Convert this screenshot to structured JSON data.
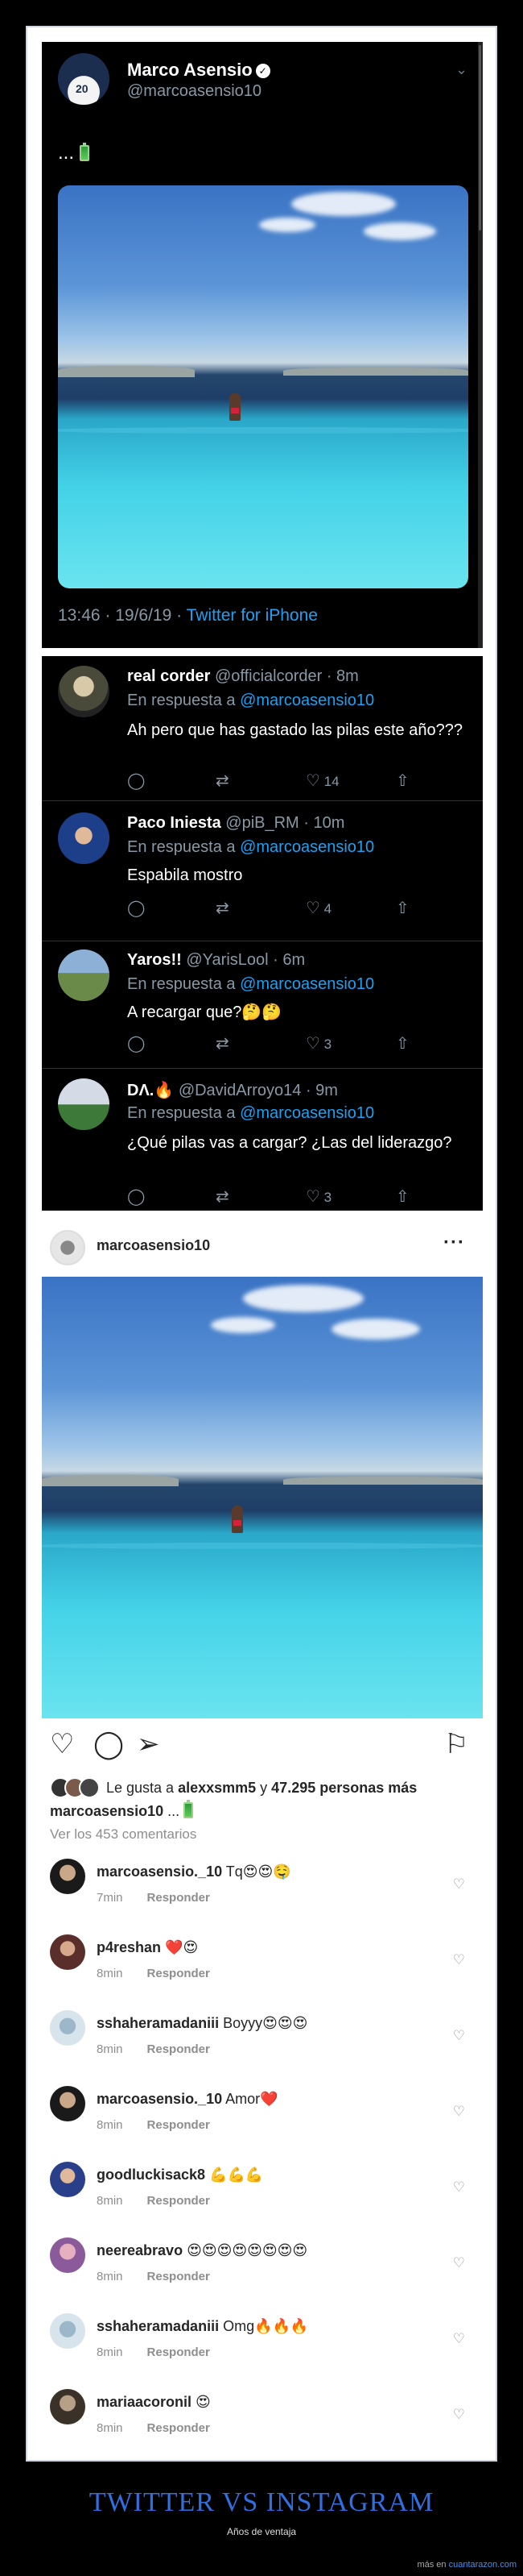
{
  "twitter": {
    "tweet": {
      "name": "Marco Asensio",
      "verified_icon": "verified-badge-icon",
      "handle": "@marcoasensio10",
      "avatar_label": "20",
      "text": "...",
      "emoji_icon": "battery-icon",
      "time": "13:46 · 19/6/19 · ",
      "source": "Twitter for iPhone"
    },
    "replies": [
      {
        "name": "real corder",
        "handle": "@officialcorder · 8m",
        "in_reply": "En respuesta a ",
        "at": "@marcoasensio10",
        "text": "Ah pero que has gastado las pilas este año???",
        "likes": "14",
        "retweets": ""
      },
      {
        "name": "Paco Iniesta",
        "handle": "@piB_RM · 10m",
        "in_reply": "En respuesta a ",
        "at": "@marcoasensio10",
        "text": "Espabila mostro",
        "likes": "4",
        "retweets": ""
      },
      {
        "name": "Yaros!!",
        "handle": "@YarisLool · 6m",
        "in_reply": "En respuesta a ",
        "at": "@marcoasensio10",
        "text": "A recargar que?🤔🤔",
        "likes": "3",
        "retweets": ""
      },
      {
        "name": "DΛ.🔥",
        "handle": "@DavidArroyo14 · 9m",
        "in_reply": "En respuesta a ",
        "at": "@marcoasensio10",
        "text": "¿Qué pilas vas a cargar? ¿Las del liderazgo?",
        "likes": "3",
        "retweets": ""
      }
    ]
  },
  "instagram": {
    "username": "marcoasensio10",
    "more": "···",
    "likes_text": "Le gusta a ",
    "likes_user": "alexxsmm5",
    "likes_and": " y ",
    "likes_count": "47.295 personas más",
    "caption_user": "marcoasensio10",
    "caption_text": " ...",
    "see_all": "Ver los 453 comentarios",
    "reply_label": "Responder",
    "comments": [
      {
        "user": "marcoasensio._10",
        "text": " Tq😍😍🤤",
        "time": "7min"
      },
      {
        "user": "p4reshan",
        "text": " ❤️😍",
        "time": "8min"
      },
      {
        "user": "sshaheramadaniii",
        "text": " Boyyy😍😍😍",
        "time": "8min"
      },
      {
        "user": "marcoasensio._10",
        "text": " Amor❤️",
        "time": "8min"
      },
      {
        "user": "goodluckisack8",
        "text": " 💪💪💪",
        "time": "8min"
      },
      {
        "user": "neereabravo",
        "text": " 😍😍😍😍😍😍😍😍",
        "time": "8min"
      },
      {
        "user": "sshaheramadaniii",
        "text": " Omg🔥🔥🔥",
        "time": "8min"
      },
      {
        "user": "mariaacoronil",
        "text": " 😍",
        "time": "8min"
      }
    ]
  },
  "footer": {
    "title": "TWITTER VS INSTAGRAM",
    "subtitle": "Años de ventaja",
    "source_prefix": "más en ",
    "source_site": "cuantarazon.com"
  },
  "colors": {
    "twitter_bg": "#000000",
    "twitter_link": "#1da1f2",
    "title_blue": "#2f6fe0"
  }
}
